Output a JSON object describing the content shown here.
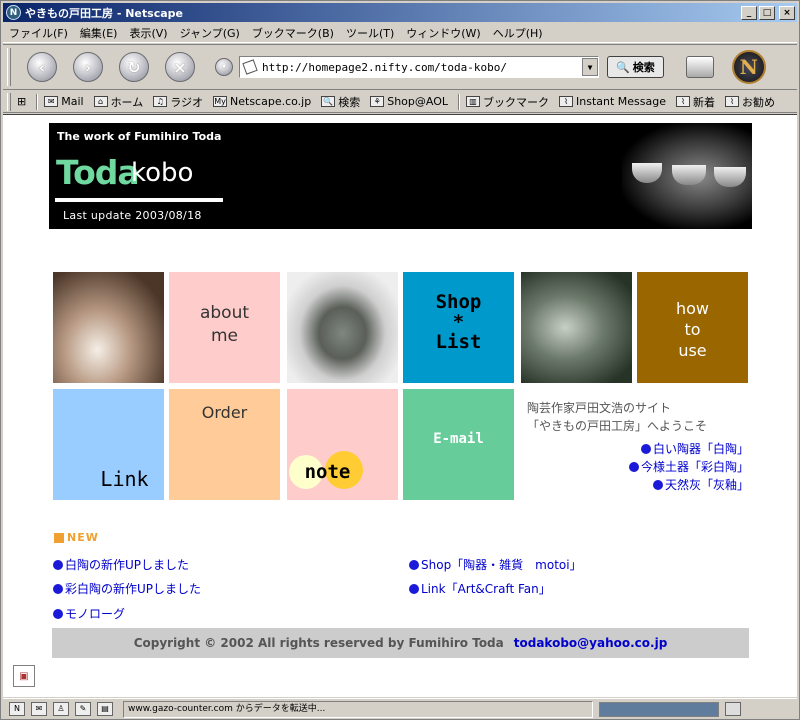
{
  "window": {
    "title": "やきもの戸田工房 - Netscape",
    "app_icon": "N",
    "min": "_",
    "max": "□",
    "close": "×"
  },
  "menu": [
    "ファイル(F)",
    "編集(E)",
    "表示(V)",
    "ジャンプ(G)",
    "ブックマーク(B)",
    "ツール(T)",
    "ウィンドウ(W)",
    "ヘルプ(H)"
  ],
  "nav": {
    "url": "http://homepage2.nifty.com/toda-kobo/",
    "search_label": "検索",
    "back": "‹",
    "forward": "›",
    "reload": "↻",
    "stop": "×",
    "logo": "N"
  },
  "personal_bar": {
    "tab_icon": "⊞",
    "items": [
      "Mail",
      "ホーム",
      "ラジオ",
      "Netscape.co.jp",
      "検索",
      "Shop@AOL",
      "ブックマーク",
      "Instant Message",
      "新着",
      "お勧め"
    ],
    "icons": {
      "mail": "✉",
      "home": "⌂",
      "radio": "♫",
      "my": "My",
      "search": "🔍",
      "shop": "⚘",
      "bookmark": "▥",
      "link": "⌇"
    }
  },
  "page": {
    "header": {
      "work_of": "The work of Fumihiro Toda",
      "logo_toda": "Toda",
      "logo_kobo": "kobo",
      "last_update": "Last update  2003/08/18"
    },
    "tiles": {
      "about": "about\nme",
      "shop": "Shop\n*\nList",
      "howto": "how\nto\nuse",
      "link": "Link",
      "order": "Order",
      "note": "note",
      "email": "E-mail"
    },
    "welcome": [
      "陶芸作家戸田文浩のサイト",
      "「やきもの戸田工房」へようこそ"
    ],
    "side_links": [
      "白い陶器「白陶」",
      "今様土器「彩白陶」",
      "天然灰「灰釉」"
    ],
    "new_heading": "NEW",
    "news_left": [
      "白陶の新作UPしました",
      "彩白陶の新作UPしました",
      "モノローグ"
    ],
    "news_right": [
      "Shop「陶器・雑貨　motoi」",
      "Link「Art&Craft Fan」"
    ],
    "copyright": "Copyright © 2002 All rights reserved by Fumihiro Toda",
    "email": "todakobo@yahoo.co.jp"
  },
  "status": {
    "text": "www.gazo-counter.com からデータを転送中..."
  },
  "colors": {
    "toda_green": "#6fd9a0",
    "about_bg": "#ffcccc",
    "shop_bg": "#0099cc",
    "howto_bg": "#996600",
    "link_bg": "#99ccff",
    "order_bg": "#ffcc99",
    "note_bg": "#ffcccc",
    "email_bg": "#66cc99",
    "link_blue": "#0000cc"
  }
}
